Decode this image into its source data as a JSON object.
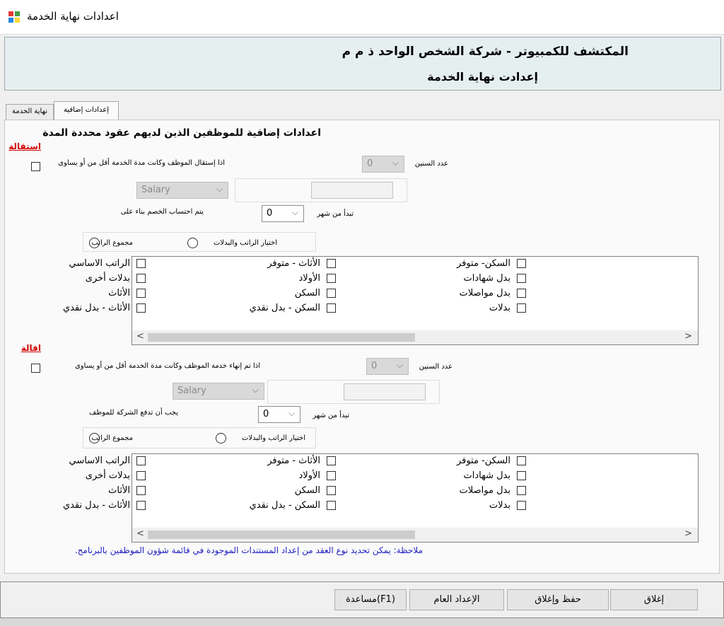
{
  "window": {
    "title": "اعدادات نهاية الخدمة"
  },
  "header": {
    "company": "المكتشف للكمبيوتر - شركة الشخص الواحد ذ م م",
    "subtitle": "إعدادت نهاية الخدمة"
  },
  "tabs": [
    {
      "label": "نهاية الخدمة",
      "active": false
    },
    {
      "label": "إعدادات إضافية",
      "active": true
    }
  ],
  "panel": {
    "heading": "اعدادات إضافية للموظفين الذين لديهم عقود محددة المدة",
    "resignation": {
      "label": "استقالة",
      "condition_label": "اذا إستقال الموظف وكانت مدة الخدمة أقل من أو يساوى",
      "years_label": "عدد السنين",
      "years_value": "0",
      "salary_combo": "Salary",
      "start_month_label": "تبدأ من شهر",
      "start_month_value": "0",
      "calc_label": "يتم احتساب الخصم بناء على",
      "radio_total": "مجموع الراتب",
      "radio_choose": "اختيار الراتب والبدلات",
      "items": [
        [
          "السكن- متوفر",
          "الأثاث - متوفر",
          "الراتب الاساسي"
        ],
        [
          "بدل شهادات",
          "الأولاد",
          "بدلات أخرى"
        ],
        [
          "بدل مواصلات",
          "السكن",
          "الأثاث"
        ],
        [
          "بدلات",
          "السكن - بدل نقدي",
          "الأثاث - بدل نقدي"
        ]
      ]
    },
    "dismissal": {
      "label": "اقالة",
      "condition_label": "اذا تم إنهاء خدمة الموظف وكانت مدة الخدمة أقل من أو يساوى",
      "years_label": "عدد السنين",
      "years_value": "0",
      "salary_combo": "Salary",
      "start_month_label": "تبدأ من شهر",
      "start_month_value": "0",
      "calc_label": "يجب أن تدفع الشركة للموظف",
      "radio_total": "مجموع الراتب",
      "radio_choose": "اختيار الراتب والبدلات",
      "items": [
        [
          "السكن- متوفر",
          "الأثاث - متوفر",
          "الراتب الاساسي"
        ],
        [
          "بدل شهادات",
          "الأولاد",
          "بدلات أخرى"
        ],
        [
          "بدل مواصلات",
          "السكن",
          "الأثاث"
        ],
        [
          "بدلات",
          "السكن - بدل نقدي",
          "الأثاث - بدل نقدي"
        ]
      ]
    },
    "note": "ملاحظة: يمكن تحديد نوع العقد من إعداد المستندات الموجودة في قائمة شؤون الموظفين بالبرنامج."
  },
  "footer": {
    "close": "إغلاق",
    "save_close": "حفظ وإغلاق",
    "general_settings": "الإعداد العام",
    "help": "(F1)مساعدة"
  },
  "colors": {
    "header_bg": "#e6eff0",
    "red_label": "#d40000",
    "note_blue": "#1d1dbf"
  }
}
